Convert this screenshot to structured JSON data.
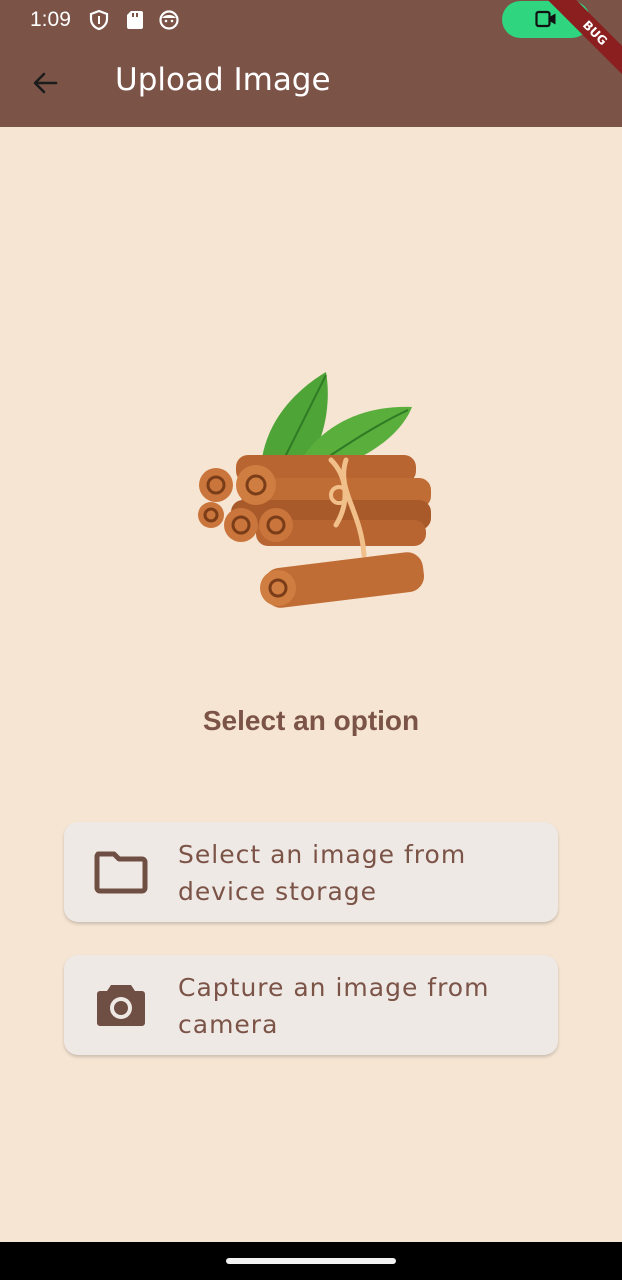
{
  "status_bar": {
    "time": "1:09",
    "icons": [
      "shield-icon",
      "sd-card-icon",
      "face-icon",
      "video-record-icon"
    ],
    "record_color": "#2fd57f"
  },
  "app_bar": {
    "title": "Upload Image",
    "back_icon": "arrow-back-icon",
    "debug_banner": "BUG",
    "background": "#7b5447"
  },
  "main": {
    "illustration": "cinnamon-sticks-icon",
    "prompt": "Select an option",
    "options": [
      {
        "icon": "folder-icon",
        "label": "Select an image from device storage"
      },
      {
        "icon": "camera-icon",
        "label": "Capture an image from camera"
      }
    ],
    "background": "#f6e5d3",
    "accent": "#7b5447"
  }
}
